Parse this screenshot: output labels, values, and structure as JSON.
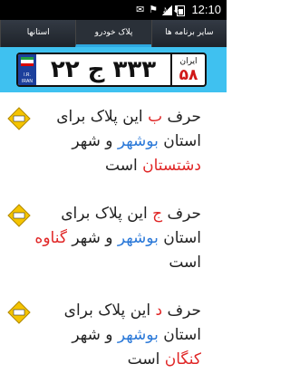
{
  "status_bar": {
    "time": "12:10",
    "icons": [
      "notification-icon",
      "notification-icon",
      "notification-icon",
      "notification-icon",
      "signal-icon",
      "battery-icon"
    ]
  },
  "tabs": [
    {
      "label": "سایر برنامه ها",
      "active": false
    },
    {
      "label": "پلاک خودرو",
      "active": true
    },
    {
      "label": "استانها",
      "active": false
    }
  ],
  "plate": {
    "digits_left": "۲۲",
    "letter": "ج",
    "digits_right": "۳۳۳",
    "country": "ایران",
    "province_code": "۵۸",
    "ir_text": [
      "I.R.",
      "IRAN"
    ]
  },
  "items": [
    {
      "pre": "حرف ",
      "letter": "ب",
      "mid1": " این پلاک برای استان ",
      "province": "بوشهر",
      "mid2": " و شهر ",
      "city": "دشتستان",
      "post": " است"
    },
    {
      "pre": "حرف ",
      "letter": "ج",
      "mid1": " این پلاک برای استان ",
      "province": "بوشهر",
      "mid2": " و شهر ",
      "city": "گناوه",
      "post": " است"
    },
    {
      "pre": "حرف ",
      "letter": "د",
      "mid1": " این پلاک برای استان ",
      "province": "بوشهر",
      "mid2": " و شهر ",
      "city": "کنگان",
      "post": " است"
    }
  ],
  "colors": {
    "accent": "#3fc1f0",
    "letter": "#e02626",
    "province": "#2a78d8",
    "tab_indicator": "#2ea8e0"
  }
}
